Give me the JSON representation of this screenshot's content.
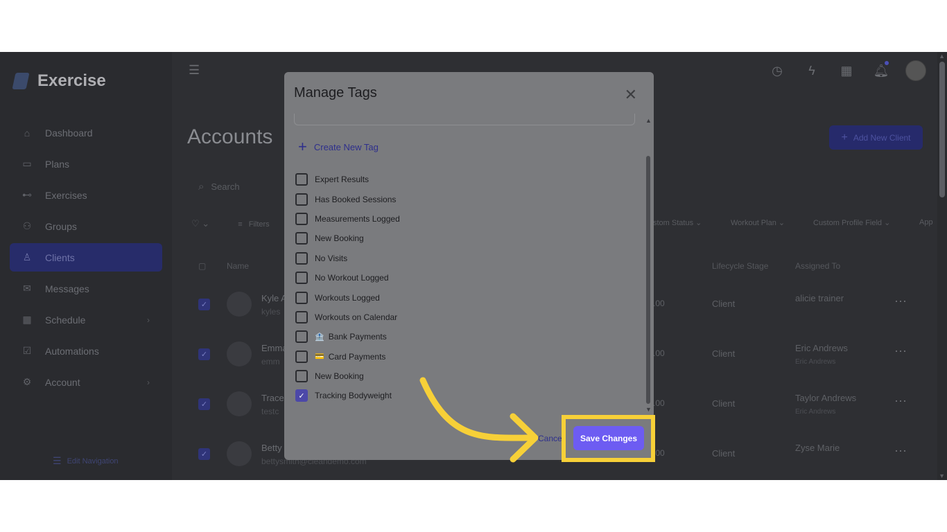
{
  "app": {
    "name": "Exercise"
  },
  "sidebar": {
    "items": [
      {
        "label": "Dashboard",
        "icon": "home-icon"
      },
      {
        "label": "Plans",
        "icon": "clipboard-icon"
      },
      {
        "label": "Exercises",
        "icon": "dumbbell-icon"
      },
      {
        "label": "Groups",
        "icon": "group-icon"
      },
      {
        "label": "Clients",
        "icon": "user-icon"
      },
      {
        "label": "Messages",
        "icon": "mail-icon"
      },
      {
        "label": "Schedule",
        "icon": "calendar-icon"
      },
      {
        "label": "Automations",
        "icon": "check-square-icon"
      },
      {
        "label": "Account",
        "icon": "gear-icon"
      }
    ],
    "edit_navigation": "Edit Navigation"
  },
  "page": {
    "title": "Accounts",
    "add_button": "Add New Client",
    "search_placeholder": "Search",
    "filters_label": "Filters",
    "columns_filter": [
      "stom Status",
      "Workout Plan",
      "Custom Profile Field",
      "App"
    ],
    "table_headers": {
      "name": "Name",
      "stage": "Lifecycle Stage",
      "assigned": "Assigned To"
    },
    "rows": [
      {
        "name": "Kyle A",
        "email": "kyles",
        "amount": ".00",
        "stage": "Client",
        "assigned": "alicie trainer",
        "assigned_sub": ""
      },
      {
        "name": "Emma",
        "email": "emm",
        "amount": ".00",
        "stage": "Client",
        "assigned": "Eric Andrews",
        "assigned_sub": "Eric Andrews"
      },
      {
        "name": "Trace",
        "email": "testc",
        "amount": ".00",
        "stage": "Client",
        "assigned": "Taylor Andrews",
        "assigned_sub": "Eric Andrews"
      },
      {
        "name": "Betty",
        "email": "bettysmith@cleandemo.com",
        "amount": ".00",
        "stage": "Client",
        "assigned": "Zyse Marie",
        "assigned_sub": ""
      }
    ]
  },
  "modal": {
    "title": "Manage Tags",
    "create_tag": "Create New Tag",
    "tags": [
      {
        "label": "Expert Results",
        "checked": false,
        "emoji": ""
      },
      {
        "label": "Has Booked Sessions",
        "checked": false,
        "emoji": ""
      },
      {
        "label": "Measurements Logged",
        "checked": false,
        "emoji": ""
      },
      {
        "label": "New Booking",
        "checked": false,
        "emoji": ""
      },
      {
        "label": "No Visits",
        "checked": false,
        "emoji": ""
      },
      {
        "label": "No Workout Logged",
        "checked": false,
        "emoji": ""
      },
      {
        "label": "Workouts Logged",
        "checked": false,
        "emoji": ""
      },
      {
        "label": "Workouts on Calendar",
        "checked": false,
        "emoji": ""
      },
      {
        "label": "Bank Payments",
        "checked": false,
        "emoji": "🏦"
      },
      {
        "label": "Card Payments",
        "checked": false,
        "emoji": "💳"
      },
      {
        "label": "New Booking",
        "checked": false,
        "emoji": ""
      },
      {
        "label": "Tracking Bodyweight",
        "checked": true,
        "emoji": ""
      }
    ],
    "cancel": "Cance",
    "save": "Save Changes"
  },
  "colors": {
    "accent": "#6d5cf2",
    "highlight": "#f7d038",
    "checked": "#4c48a8"
  }
}
